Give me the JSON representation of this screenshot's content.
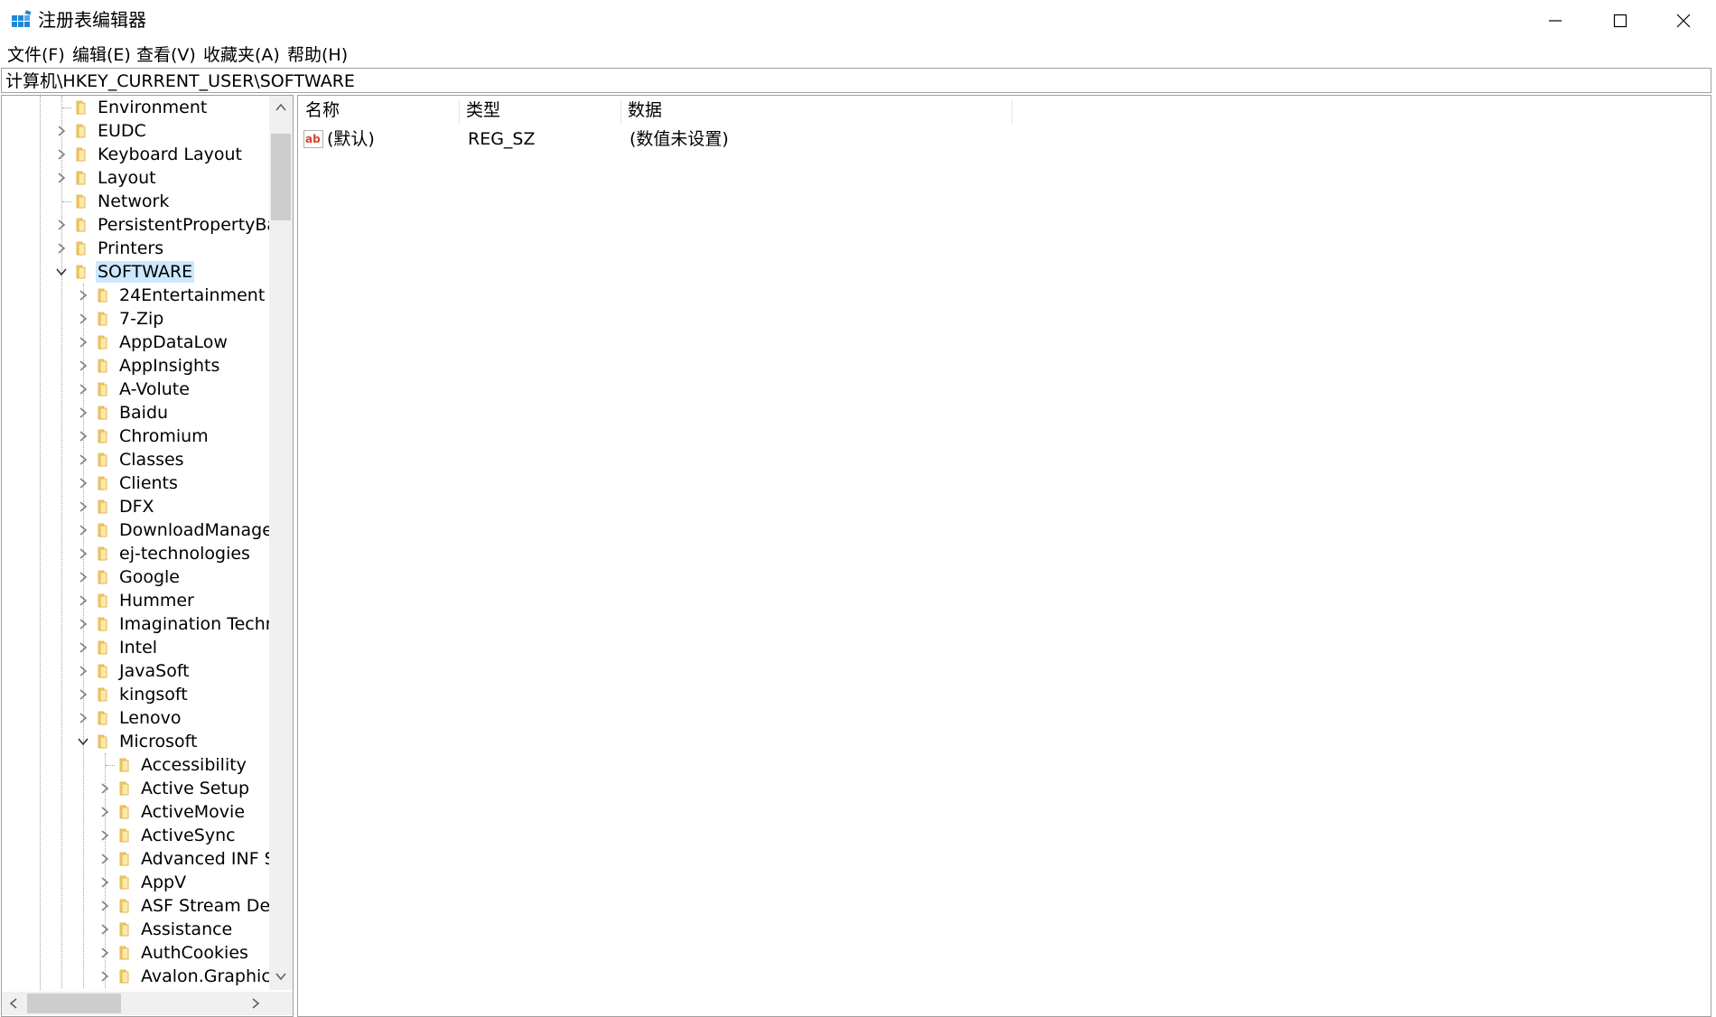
{
  "window": {
    "title": "注册表编辑器",
    "controls": {
      "minimize": "minimize-icon",
      "maximize": "maximize-icon",
      "close": "close-icon"
    }
  },
  "menu": [
    "文件(F)",
    "编辑(E)",
    "查看(V)",
    "收藏夹(A)",
    "帮助(H)"
  ],
  "address": "计算机\\HKEY_CURRENT_USER\\SOFTWARE",
  "tree": [
    {
      "label": "Environment",
      "level": 0,
      "expander": "none"
    },
    {
      "label": "EUDC",
      "level": 0,
      "expander": "collapsed"
    },
    {
      "label": "Keyboard Layout",
      "level": 0,
      "expander": "collapsed"
    },
    {
      "label": "Layout",
      "level": 0,
      "expander": "collapsed"
    },
    {
      "label": "Network",
      "level": 0,
      "expander": "none"
    },
    {
      "label": "PersistentPropertyBag",
      "level": 0,
      "expander": "collapsed"
    },
    {
      "label": "Printers",
      "level": 0,
      "expander": "collapsed"
    },
    {
      "label": "SOFTWARE",
      "level": 0,
      "expander": "expanded",
      "selected": true
    },
    {
      "label": "24Entertainment",
      "level": 1,
      "expander": "collapsed"
    },
    {
      "label": "7-Zip",
      "level": 1,
      "expander": "collapsed"
    },
    {
      "label": "AppDataLow",
      "level": 1,
      "expander": "collapsed"
    },
    {
      "label": "AppInsights",
      "level": 1,
      "expander": "collapsed"
    },
    {
      "label": "A-Volute",
      "level": 1,
      "expander": "collapsed"
    },
    {
      "label": "Baidu",
      "level": 1,
      "expander": "collapsed"
    },
    {
      "label": "Chromium",
      "level": 1,
      "expander": "collapsed"
    },
    {
      "label": "Classes",
      "level": 1,
      "expander": "collapsed"
    },
    {
      "label": "Clients",
      "level": 1,
      "expander": "collapsed"
    },
    {
      "label": "DFX",
      "level": 1,
      "expander": "collapsed"
    },
    {
      "label": "DownloadManager",
      "level": 1,
      "expander": "collapsed"
    },
    {
      "label": "ej-technologies",
      "level": 1,
      "expander": "collapsed"
    },
    {
      "label": "Google",
      "level": 1,
      "expander": "collapsed"
    },
    {
      "label": "Hummer",
      "level": 1,
      "expander": "collapsed"
    },
    {
      "label": "Imagination Technc",
      "level": 1,
      "expander": "collapsed"
    },
    {
      "label": "Intel",
      "level": 1,
      "expander": "collapsed"
    },
    {
      "label": "JavaSoft",
      "level": 1,
      "expander": "collapsed"
    },
    {
      "label": "kingsoft",
      "level": 1,
      "expander": "collapsed"
    },
    {
      "label": "Lenovo",
      "level": 1,
      "expander": "collapsed"
    },
    {
      "label": "Microsoft",
      "level": 1,
      "expander": "expanded"
    },
    {
      "label": "Accessibility",
      "level": 2,
      "expander": "none"
    },
    {
      "label": "Active Setup",
      "level": 2,
      "expander": "collapsed"
    },
    {
      "label": "ActiveMovie",
      "level": 2,
      "expander": "collapsed"
    },
    {
      "label": "ActiveSync",
      "level": 2,
      "expander": "collapsed"
    },
    {
      "label": "Advanced INF Se",
      "level": 2,
      "expander": "collapsed"
    },
    {
      "label": "AppV",
      "level": 2,
      "expander": "collapsed"
    },
    {
      "label": "ASF Stream Desc",
      "level": 2,
      "expander": "collapsed"
    },
    {
      "label": "Assistance",
      "level": 2,
      "expander": "collapsed"
    },
    {
      "label": "AuthCookies",
      "level": 2,
      "expander": "collapsed"
    },
    {
      "label": "Avalon.Graphics",
      "level": 2,
      "expander": "collapsed"
    }
  ],
  "columns": [
    "名称",
    "类型",
    "数据"
  ],
  "values": [
    {
      "icon": "string-value-icon",
      "name": "(默认)",
      "type": "REG_SZ",
      "data": "(数值未设置)"
    }
  ],
  "colors": {
    "selection": "#cce8ff",
    "folder": "#f6d373",
    "border": "#a0a0a0"
  }
}
